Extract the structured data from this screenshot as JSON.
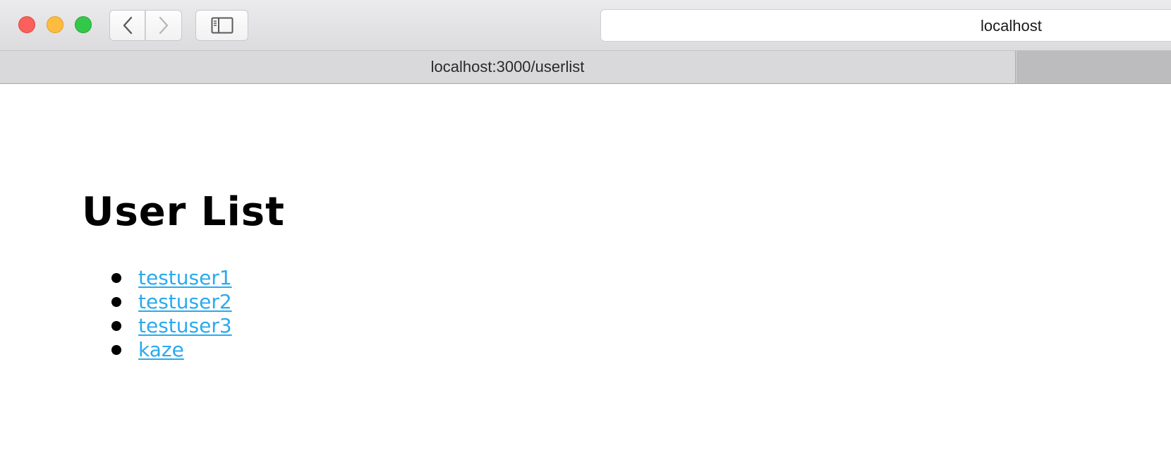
{
  "window": {
    "traffic_lights": [
      "close",
      "minimize",
      "maximize"
    ]
  },
  "toolbar": {
    "back_icon": "chevron-left-icon",
    "forward_icon": "chevron-right-icon",
    "sidebar_icon": "sidebar-icon",
    "address_text": "localhost"
  },
  "tabs": {
    "active_title": "localhost:3000/userlist"
  },
  "page": {
    "title": "User List",
    "users": [
      "testuser1",
      "testuser2",
      "testuser3",
      "kaze"
    ]
  },
  "colors": {
    "link": "#2aaaee",
    "close": "#fc605b",
    "minimize": "#fdbc40",
    "maximize": "#34c84a"
  }
}
